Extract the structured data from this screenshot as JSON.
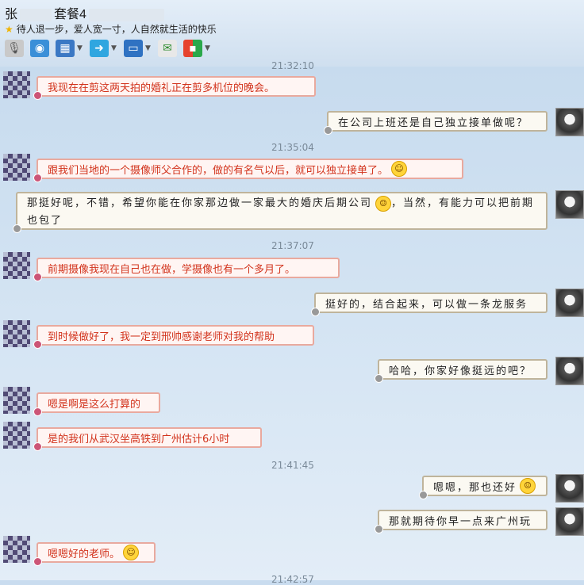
{
  "header": {
    "title_name": "张",
    "title_package": "套餐4",
    "signature": "待人退一步，爱人宽一寸，人自然就生活的快乐"
  },
  "toolbar": {
    "icons": [
      "microphone-icon",
      "video-call-icon",
      "remote-screen-icon",
      "file-transfer-icon",
      "screen-share-icon",
      "sms-icon",
      "apps-icon"
    ]
  },
  "colors": {
    "incoming_text": "#d2331c",
    "incoming_border": "#e9a99e",
    "outgoing_border": "#bfb49b"
  },
  "chat": {
    "timestamps": [
      "21:32:10",
      "21:35:04",
      "21:37:07",
      "21:41:45",
      "21:42:57"
    ],
    "messages": [
      {
        "dir": "in",
        "text": "我现在在剪这两天拍的婚礼正在剪多机位的晚会。"
      },
      {
        "dir": "out",
        "text": "在公司上班还是自己独立接单做呢？"
      },
      {
        "dir": "in",
        "text": "跟我们当地的一个摄像师父合作的，做的有名气以后，就可以独立接单了。"
      },
      {
        "dir": "out",
        "text": "那挺好呢，不错，希望你能在你家那边做一家最大的婚庆后期公司",
        "text2": "，当然，有能力可以把前期也包了"
      },
      {
        "dir": "in",
        "text": "前期摄像我现在自己也在做，学摄像也有一个多月了。"
      },
      {
        "dir": "out",
        "text": "挺好的，结合起来，可以做一条龙服务"
      },
      {
        "dir": "in",
        "text": "到时候做好了，我一定到邢帅感谢老师对我的帮助"
      },
      {
        "dir": "out",
        "text": "哈哈，你家好像挺远的吧？"
      },
      {
        "dir": "in",
        "text": "嗯是啊是这么打算的"
      },
      {
        "dir": "in",
        "text": "是的我们从武汉坐高铁到广州估计6小时"
      },
      {
        "dir": "out",
        "text": "嗯嗯，那也还好"
      },
      {
        "dir": "out",
        "text": "那就期待你早一点来广州玩"
      },
      {
        "dir": "in",
        "text": "嗯嗯好的老师。"
      }
    ]
  }
}
